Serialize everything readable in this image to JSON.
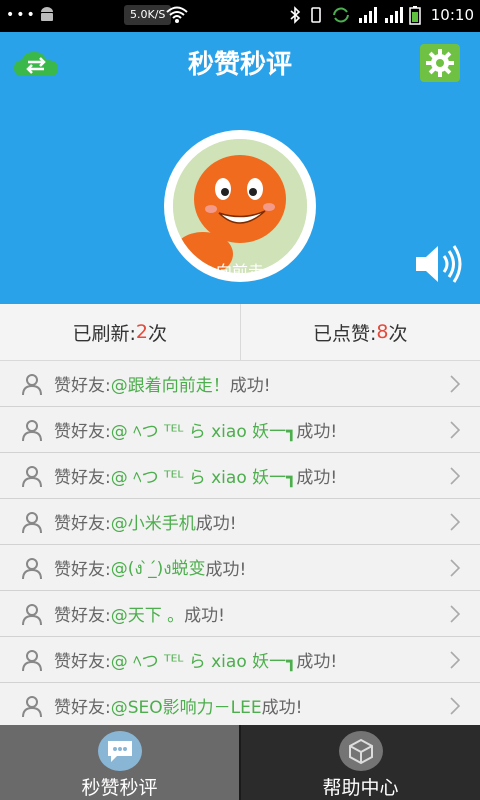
{
  "status_bar": {
    "dots": "•••",
    "net_speed": "5.0K/S",
    "time": "10:10"
  },
  "header": {
    "title": "秒赞秒评",
    "username": "向前走",
    "colors": {
      "header_bg": "#2aa2ea",
      "gear_bg": "#6fc144"
    },
    "icons": [
      "cloud-sync-icon",
      "gear-icon",
      "speaker-icon"
    ]
  },
  "stats": {
    "refreshed_label": "已刷新:",
    "refreshed_count": "2",
    "refreshed_unit": "次",
    "liked_label": "已点赞:",
    "liked_count": "8",
    "liked_unit": "次"
  },
  "list": {
    "items": [
      {
        "prefix": "赞好友: ",
        "target": "@跟着向前走！",
        "suffix": "成功!"
      },
      {
        "prefix": "赞好友: ",
        "target": "@ ﾍつ ᵀᴱᴸ ら xiao 妖一┓",
        "suffix": "成功!"
      },
      {
        "prefix": "赞好友: ",
        "target": "@ ﾍつ ᵀᴱᴸ ら xiao 妖一┓",
        "suffix": "成功!"
      },
      {
        "prefix": "赞好友: ",
        "target": "@小米手机",
        "suffix": "成功!"
      },
      {
        "prefix": "赞好友: ",
        "target": "@(ง ̀_́)ง蜕变",
        "suffix": "成功!"
      },
      {
        "prefix": "赞好友: ",
        "target": "@天下 。",
        "suffix": "成功!"
      },
      {
        "prefix": "赞好友: ",
        "target": "@ ﾍつ ᵀᴱᴸ ら xiao 妖一┓",
        "suffix": "成功!"
      },
      {
        "prefix": "赞好友: ",
        "target": "@SEO影响力－LEE",
        "suffix": "成功!"
      }
    ]
  },
  "tabs": [
    {
      "label": "秒赞秒评",
      "icon": "chat-bubble-icon"
    },
    {
      "label": "帮助中心",
      "icon": "cube-icon"
    }
  ]
}
